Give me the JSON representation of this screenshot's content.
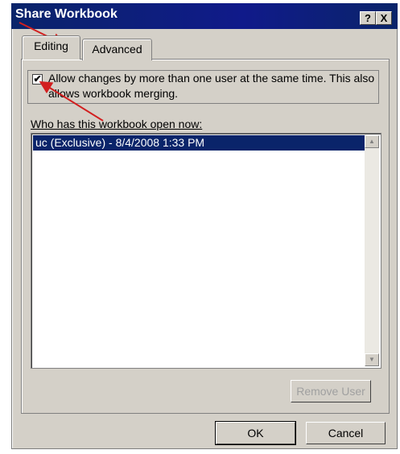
{
  "window": {
    "title": "Share Workbook",
    "help_label": "?",
    "close_label": "X"
  },
  "tabs": [
    {
      "label": "Editing",
      "active": true
    },
    {
      "label": "Advanced",
      "active": false
    }
  ],
  "allow_multi_user": {
    "checked": true,
    "check_glyph": "✔",
    "label": "Allow changes by more than one user at the same time.  This also allows workbook merging."
  },
  "users": {
    "label": "Who has this workbook open now:",
    "items": [
      "uc (Exclusive) - 8/4/2008 1:33 PM"
    ]
  },
  "buttons": {
    "remove_user": "Remove User",
    "ok": "OK",
    "cancel": "Cancel"
  },
  "colors": {
    "titlebar": "#0a246a",
    "dialog_bg": "#d4d0c8",
    "selection": "#0a246a",
    "annotation_arrow": "#d21f1f"
  }
}
